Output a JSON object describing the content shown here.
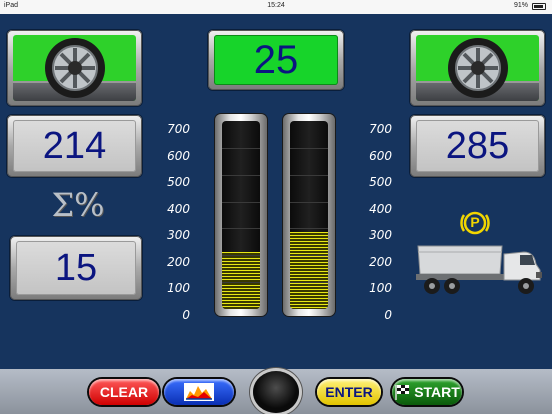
{
  "statusbar": {
    "carrier": "iPad",
    "time": "15:24",
    "battery": "91%"
  },
  "top_value": "25",
  "left": {
    "value": "214",
    "sum_label": "Σ%",
    "sum_value": "15"
  },
  "right": {
    "value": "285"
  },
  "scale_labels": [
    "700",
    "600",
    "500",
    "400",
    "300",
    "200",
    "100",
    "0"
  ],
  "bars": [
    {
      "name": "left",
      "level": 214,
      "max": 700
    },
    {
      "name": "right",
      "level": 285,
      "max": 700
    }
  ],
  "parking_label": "P",
  "toolbar": {
    "clear_label": "CLEAR",
    "enter_label": "ENTER",
    "start_label": "START"
  },
  "colors": {
    "background": "#16345e",
    "digits": "#0b1580",
    "green_screen": "#17d42a",
    "bar_fill": "#e8e815",
    "parking": "#f2d600"
  }
}
